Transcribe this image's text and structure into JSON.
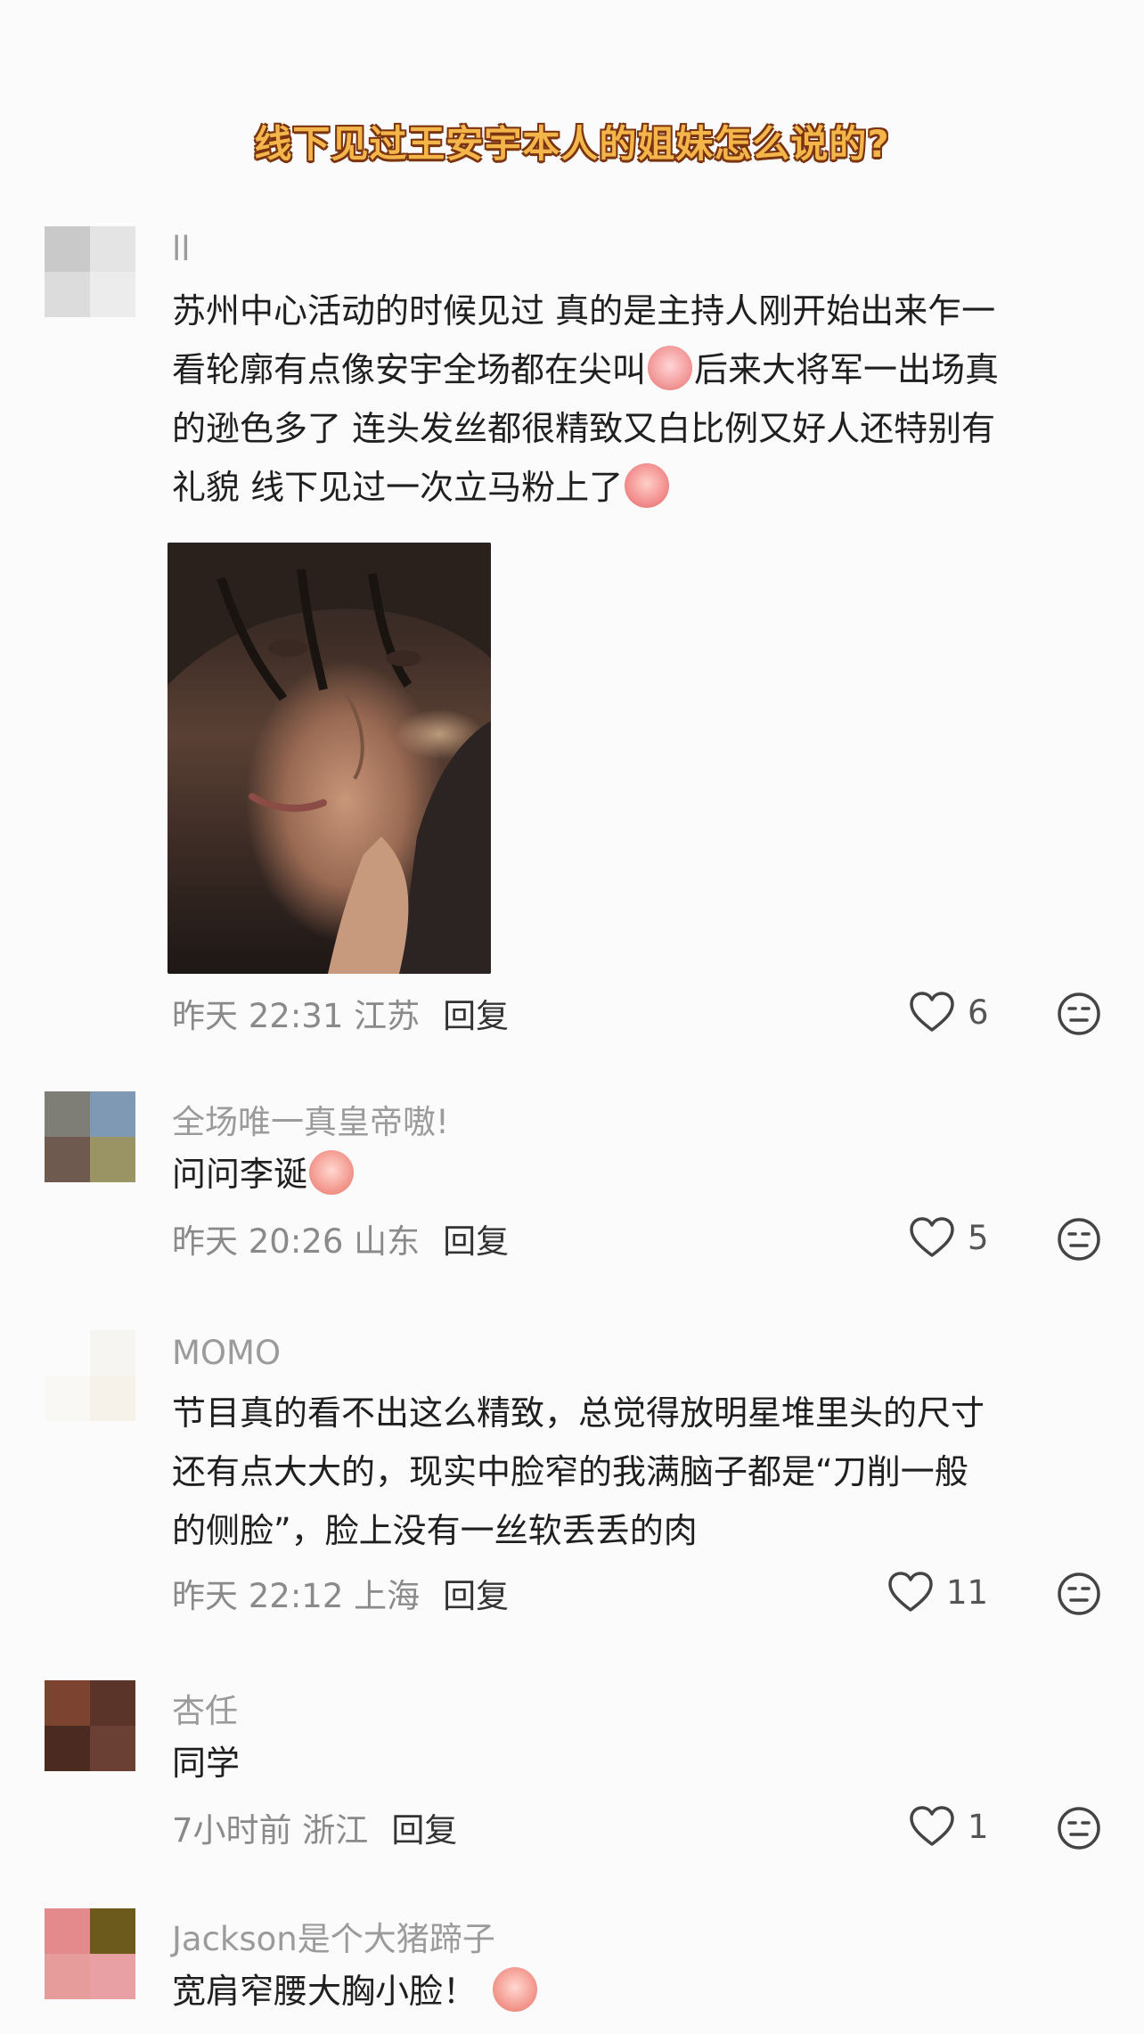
{
  "banner": {
    "title": "线下见过王安宇本人的姐妹怎么说的?"
  },
  "reply_label": "回复",
  "comments": [
    {
      "username": "ll",
      "lines": [
        "苏州中心活动的时候见过 真的是主持人刚开始出来乍一",
        "看轮廓有点像安宇全场都在尖叫",
        "后来大将军一出场真",
        "的逊色多了 连头发丝都很精致又白比例又好人还特别有",
        "礼貌 线下见过一次立马粉上了"
      ],
      "time_location": "昨天 22:31 江苏",
      "likes": "6",
      "avatar_colors": [
        "#c9c9c9",
        "#e4e4e4",
        "#dcdcdc",
        "#ececec"
      ]
    },
    {
      "username": "全场唯一真皇帝嗷!",
      "text": "问问李诞",
      "time_location": "昨天 20:26 山东",
      "likes": "5",
      "avatar_colors": [
        "#7e7e76",
        "#7f98b4",
        "#6f5a50",
        "#9a9364"
      ]
    },
    {
      "username": "MOMO",
      "lines": [
        "节目真的看不出这么精致，总觉得放明星堆里头的尺寸",
        "还有点大大的，现实中脸窄的我满脑子都是“刀削一般",
        "的侧脸”，脸上没有一丝软丢丢的肉"
      ],
      "time_location": "昨天 22:12 上海",
      "likes": "11",
      "avatar_colors": [
        "#fbfbfb",
        "#f7f5f1",
        "#f9f8f5",
        "#f6f2ea"
      ]
    },
    {
      "username": "杏任",
      "text": "同学",
      "time_location": "7小时前 浙江",
      "likes": "1",
      "avatar_colors": [
        "#7d4331",
        "#5a3428",
        "#4b2a22",
        "#6b4034"
      ]
    },
    {
      "username": "Jackson是个大猪蹄子",
      "text": "宽肩窄腰大胸小脸！",
      "avatar_colors": [
        "#e58a8c",
        "#6c5a1c",
        "#e79c9c",
        "#e9a0a4"
      ]
    }
  ],
  "icons": {
    "heart": "heart-icon",
    "face": "neutral-face-icon",
    "emoji": "peach-emoji"
  },
  "colors": {
    "banner_fill": "#f4b64a",
    "banner_outline": "#7a3510",
    "username": "#9b9b9b",
    "meta": "#8a8a8a"
  }
}
